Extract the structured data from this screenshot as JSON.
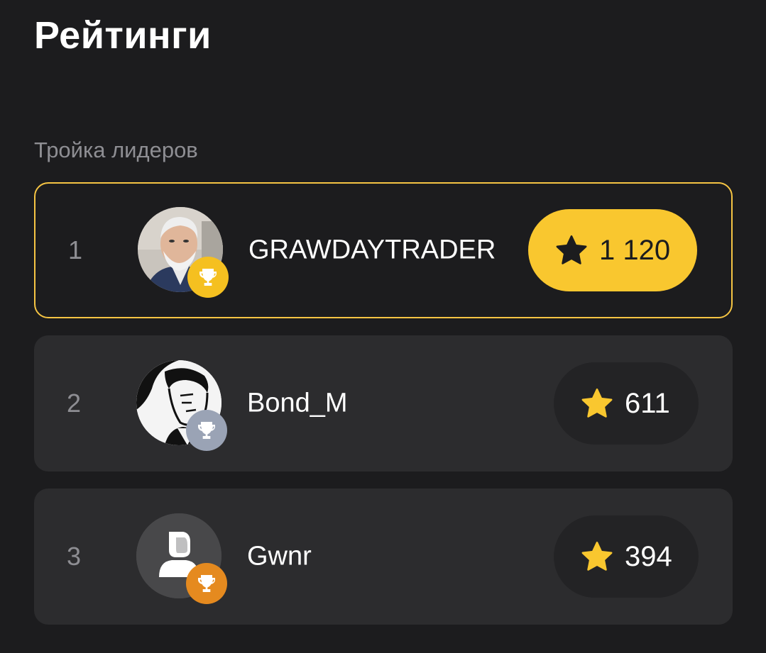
{
  "header": {
    "title": "Рейтинги"
  },
  "section": {
    "label": "Тройка лидеров"
  },
  "leaders": [
    {
      "rank": "1",
      "name": "GRAWDAYTRADER",
      "score": "1 120",
      "trophy": "gold-trophy-icon"
    },
    {
      "rank": "2",
      "name": "Bond_M",
      "score": "611",
      "trophy": "silver-trophy-icon"
    },
    {
      "rank": "3",
      "name": "Gwnr",
      "score": "394",
      "trophy": "bronze-trophy-icon"
    }
  ],
  "colors": {
    "background": "#1c1c1e",
    "card": "#2c2c2e",
    "accent_gold": "#f9c72f",
    "silver": "#9aa3b5",
    "bronze": "#e58a1f",
    "muted_text": "#8e8e93"
  }
}
